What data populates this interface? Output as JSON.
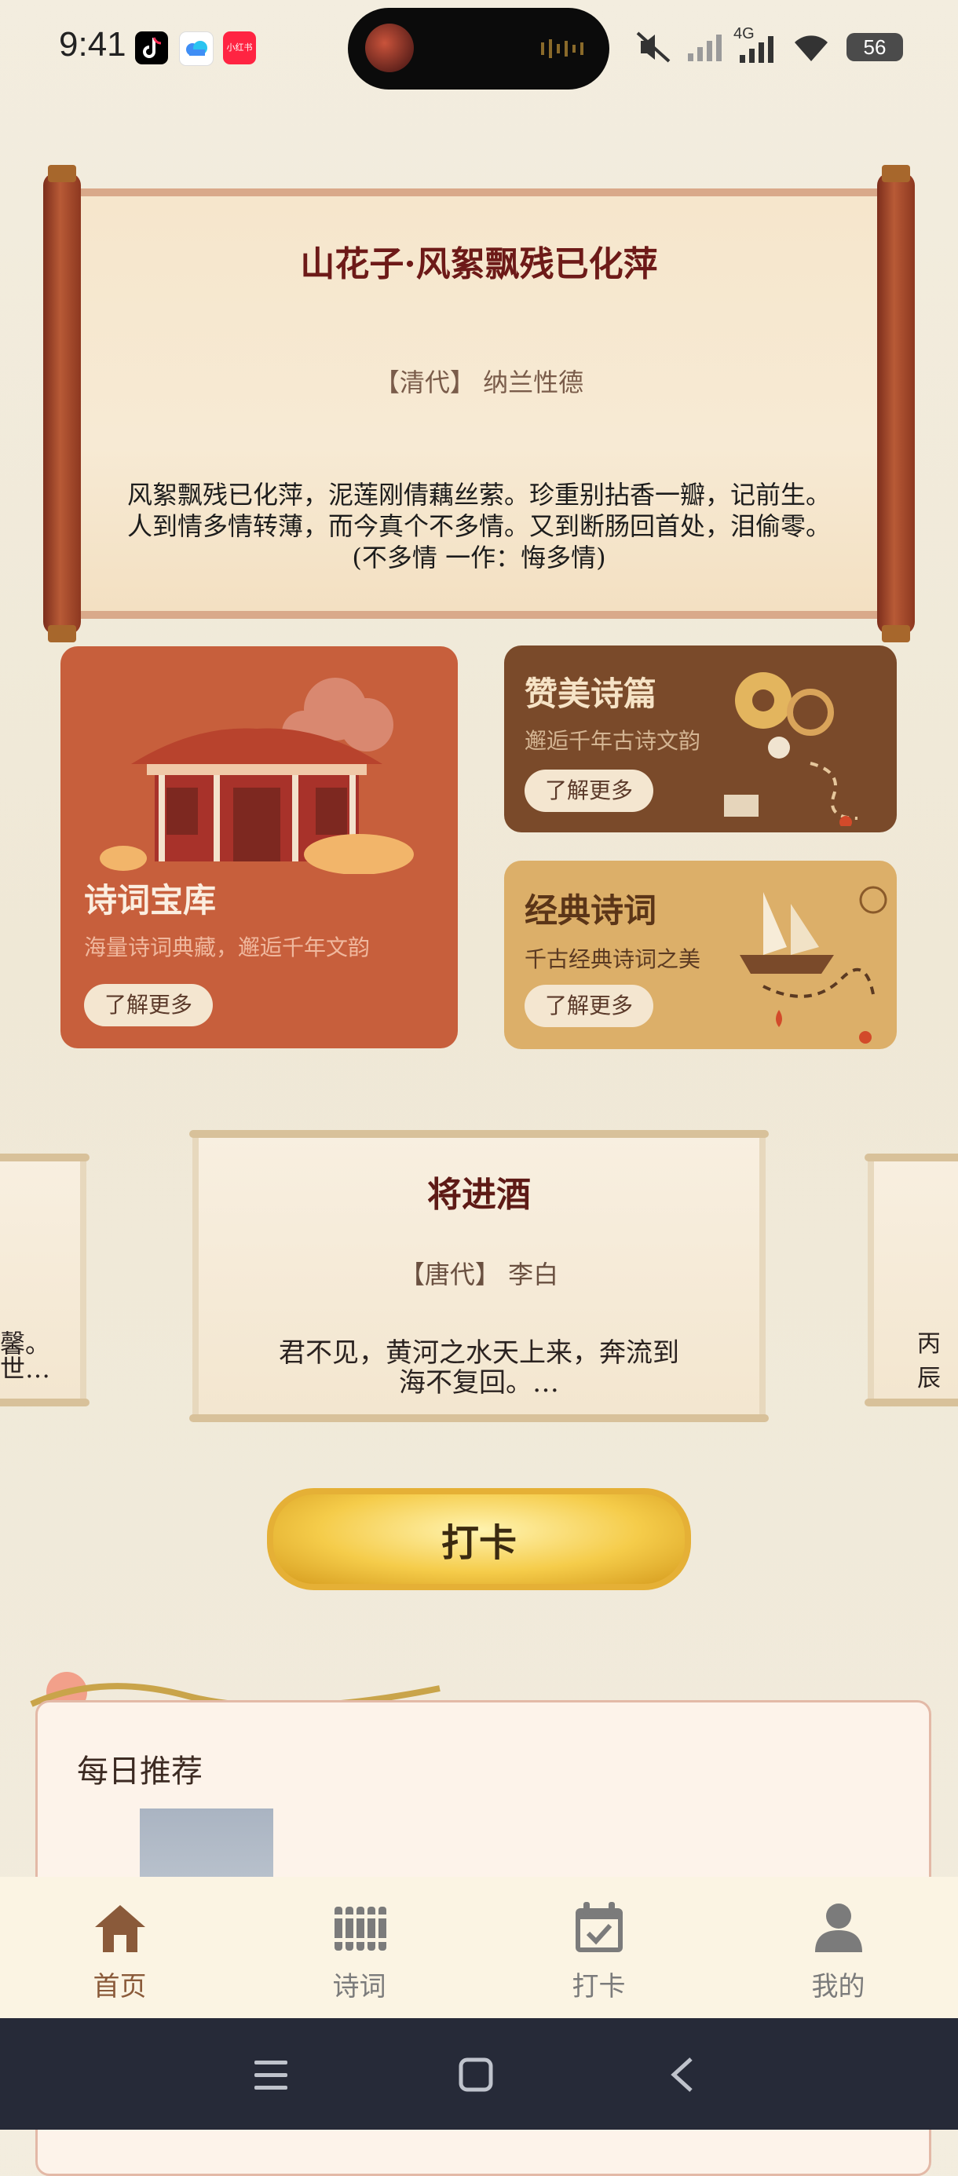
{
  "status_bar": {
    "time": "9:41",
    "battery": "56",
    "network": "4G",
    "app_icons": [
      "tiktok-icon",
      "cloud-icon",
      "xiaohongshu-icon"
    ],
    "xiaohongshu_text": "小红书"
  },
  "featured_poem": {
    "title": "山花子·风絮飘残已化萍",
    "author": "【清代】 纳兰性德",
    "lines": [
      "风絮飘残已化萍，泥莲刚倩藕丝萦。珍重别拈香一瓣，记前生。",
      "人到情多情转薄，而今真个不多情。又到断肠回首处，泪偷零。",
      "(不多情 一作：悔多情)"
    ]
  },
  "cards": {
    "library": {
      "title": "诗词宝库",
      "subtitle": "海量诗词典藏，邂逅千年文韵",
      "button": "了解更多"
    },
    "praise": {
      "title": "赞美诗篇",
      "subtitle": "邂逅千年古诗文韵",
      "button": "了解更多"
    },
    "classic": {
      "title": "经典诗词",
      "subtitle": "千古经典诗词之美",
      "button": "了解更多"
    }
  },
  "carousel": {
    "center": {
      "title": "将进酒",
      "author": "【唐代】 李白",
      "lines": [
        "君不见，黄河之水天上来，奔流到",
        "海不复回。…"
      ]
    },
    "left_fragment": [
      "馨。",
      "世…"
    ],
    "right_fragment": [
      "丙辰"
    ]
  },
  "checkin_button": "打卡",
  "daily": {
    "label": "每日推荐"
  },
  "tabs": [
    {
      "label": "首页",
      "icon": "home-icon",
      "active": true
    },
    {
      "label": "诗词",
      "icon": "bamboo-scroll-icon",
      "active": false
    },
    {
      "label": "打卡",
      "icon": "calendar-check-icon",
      "active": false
    },
    {
      "label": "我的",
      "icon": "user-icon",
      "active": false
    }
  ],
  "colors": {
    "accent_active": "#8a5a3a",
    "tab_inactive": "#7b7b7b",
    "library_card": "#c75f3c",
    "praise_card": "#7a4a2a",
    "classic_card": "#dcaf69"
  }
}
